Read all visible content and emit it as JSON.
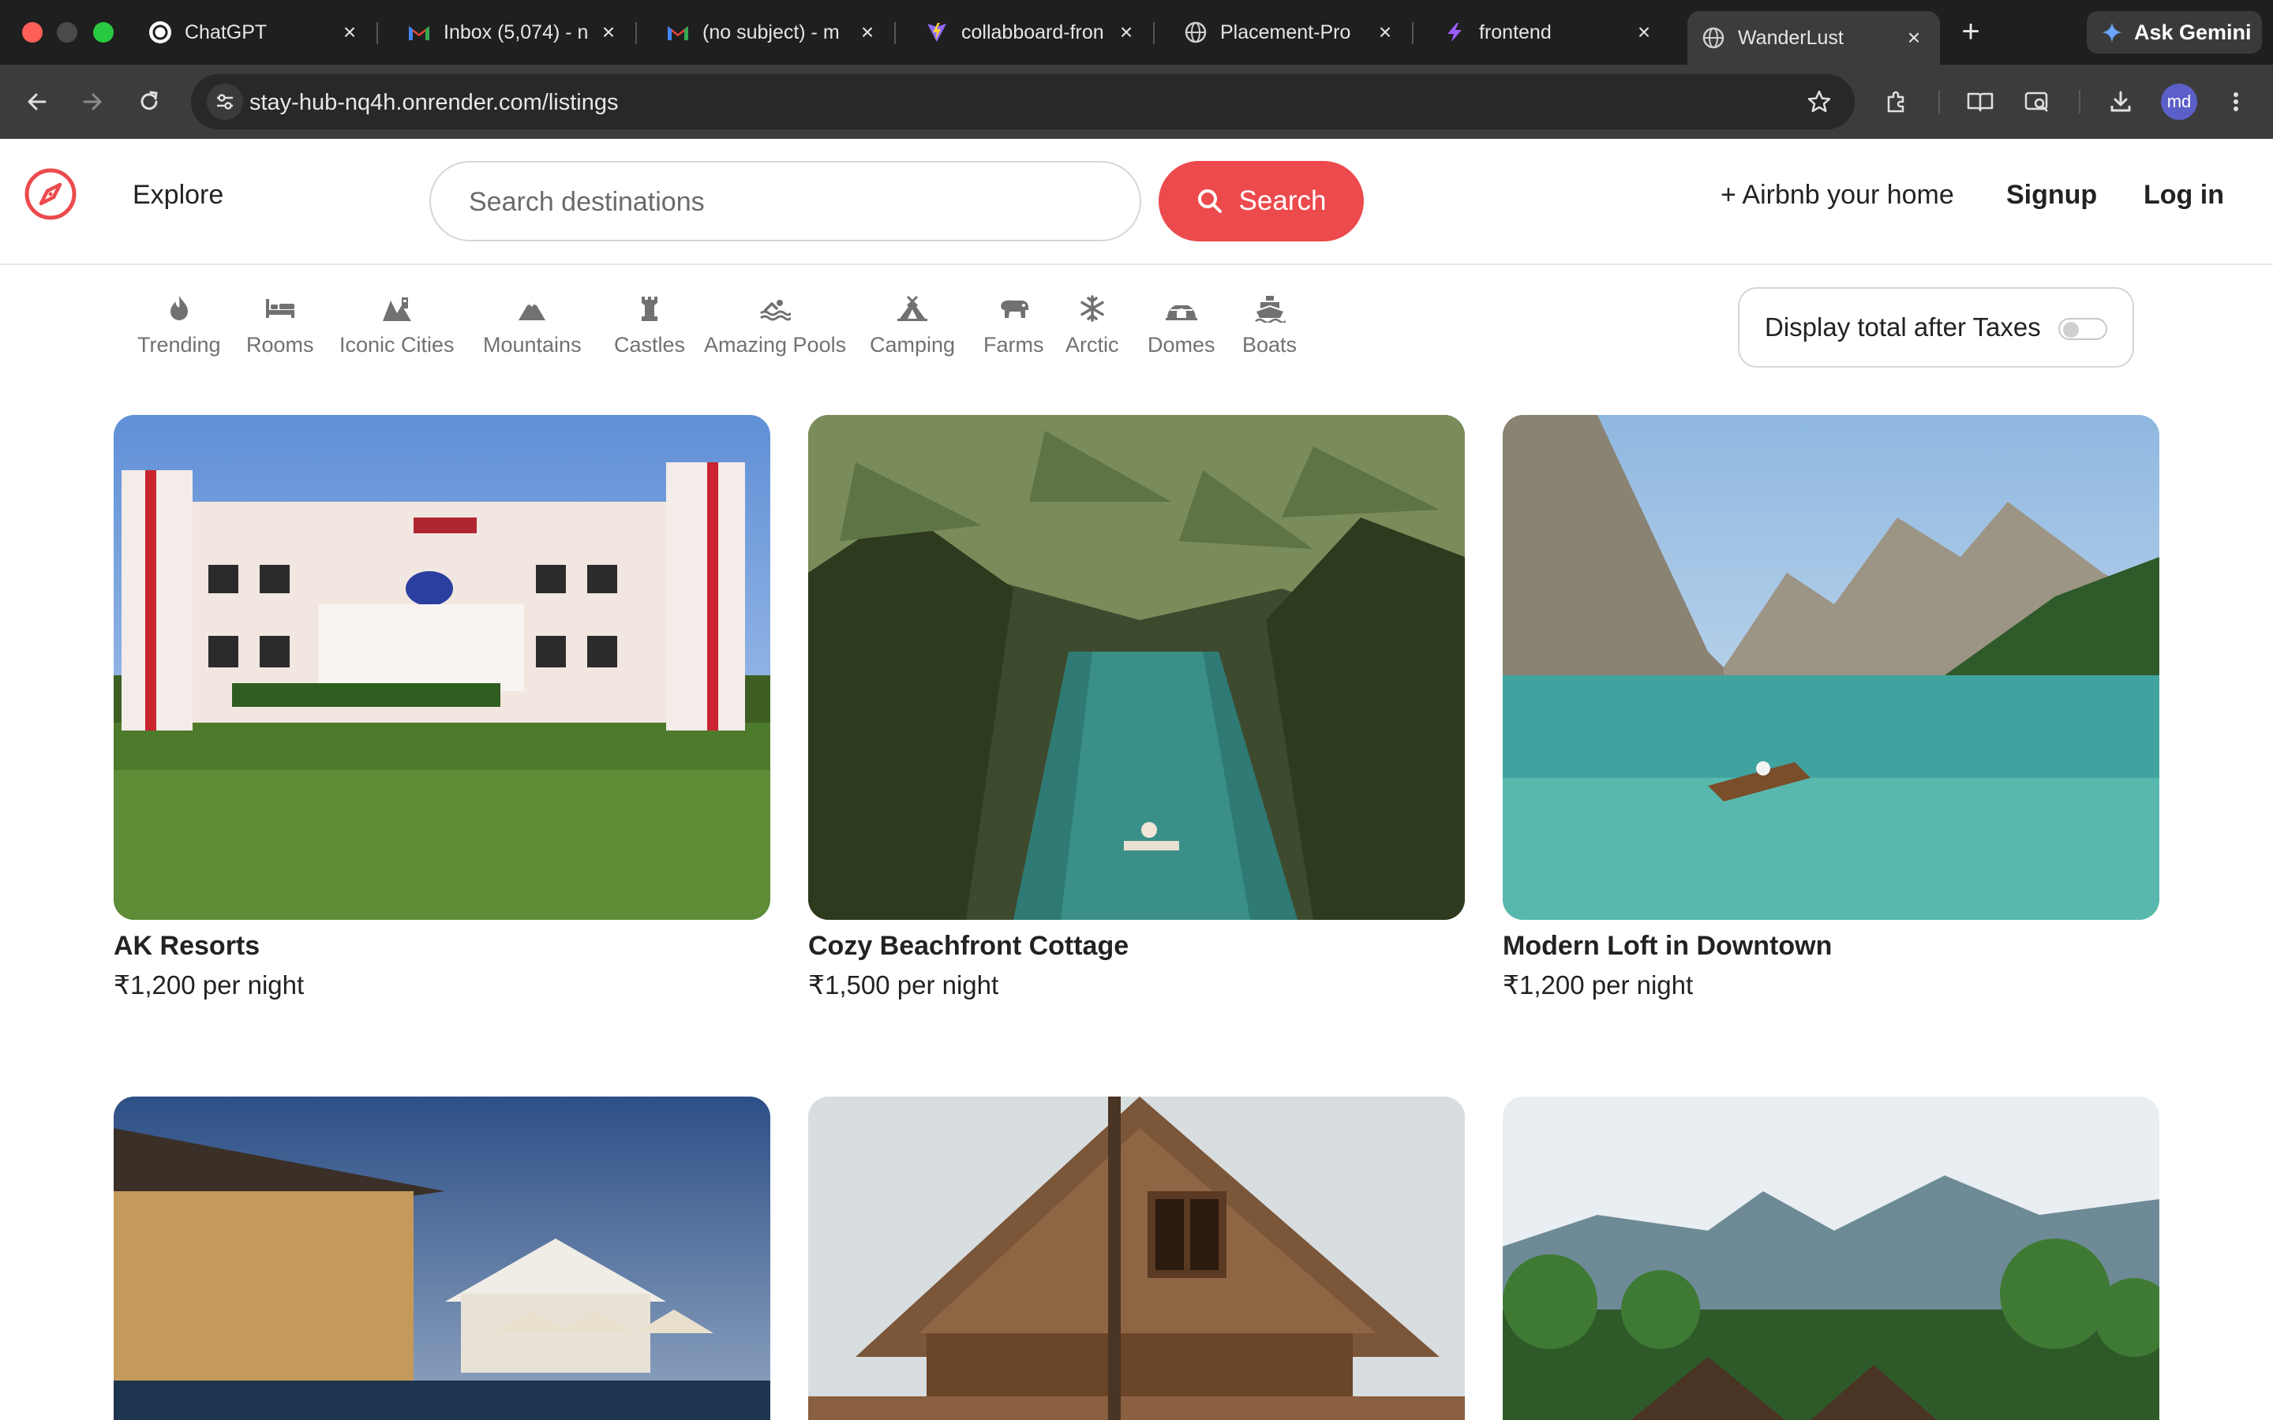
{
  "browser": {
    "tabs": [
      {
        "title": "ChatGPT",
        "icon": "chatgpt-icon",
        "active": false
      },
      {
        "title": "Inbox (5,074) - n",
        "icon": "gmail-icon",
        "active": false
      },
      {
        "title": "(no subject) - m",
        "icon": "gmail-icon",
        "active": false
      },
      {
        "title": "collabboard-fron",
        "icon": "vite-icon",
        "active": false
      },
      {
        "title": "Placement-Pro",
        "icon": "globe-icon",
        "active": false
      },
      {
        "title": "frontend",
        "icon": "bolt-icon",
        "active": false
      },
      {
        "title": "WanderLust",
        "icon": "globe-icon",
        "active": true
      }
    ],
    "gemini_label": "Ask Gemini",
    "url": "stay-hub-nq4h.onrender.com/listings",
    "profile_initials": "md"
  },
  "navbar": {
    "explore_label": "Explore",
    "search_placeholder": "Search destinations",
    "search_button_label": "Search",
    "airbnb_label": "+ Airbnb your home",
    "signup_label": "Signup",
    "login_label": "Log in",
    "brand_color": "#ec4a4c"
  },
  "filters": [
    {
      "label": "Trending",
      "icon": "fire-icon"
    },
    {
      "label": "Rooms",
      "icon": "bed-icon"
    },
    {
      "label": "Iconic Cities",
      "icon": "city-icon"
    },
    {
      "label": "Mountains",
      "icon": "mountain-icon"
    },
    {
      "label": "Castles",
      "icon": "castle-icon"
    },
    {
      "label": "Amazing Pools",
      "icon": "pool-icon"
    },
    {
      "label": "Camping",
      "icon": "campground-icon"
    },
    {
      "label": "Farms",
      "icon": "cow-icon"
    },
    {
      "label": "Arctic",
      "icon": "snowflake-icon"
    },
    {
      "label": "Domes",
      "icon": "igloo-icon"
    },
    {
      "label": "Boats",
      "icon": "ship-icon"
    }
  ],
  "tax_toggle": {
    "label": "Display total after Taxes",
    "on": false
  },
  "listings": [
    {
      "title": "AK Resorts",
      "price": "₹1,200 per night"
    },
    {
      "title": "Cozy Beachfront Cottage",
      "price": "₹1,500 per night"
    },
    {
      "title": "Modern Loft in Downtown",
      "price": "₹1,200 per night"
    },
    {
      "title": "",
      "price": ""
    },
    {
      "title": "",
      "price": ""
    },
    {
      "title": "",
      "price": ""
    }
  ]
}
